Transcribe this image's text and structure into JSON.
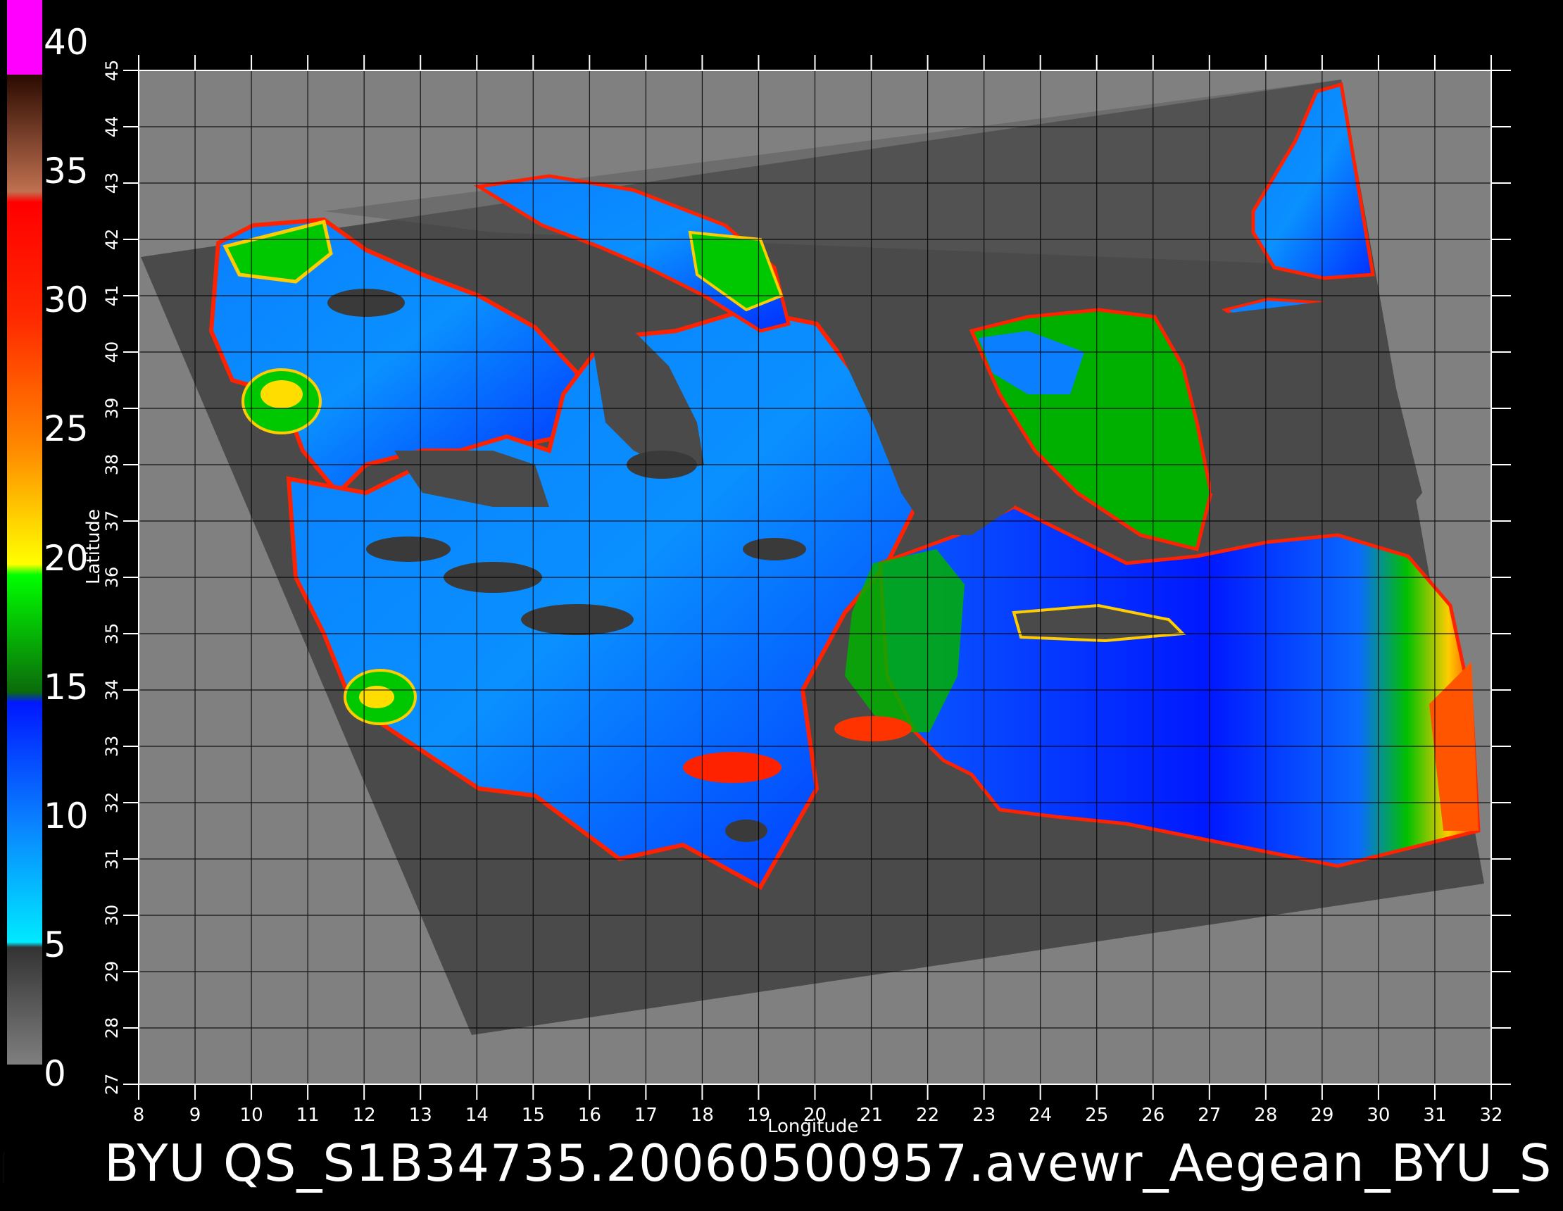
{
  "map": {
    "region": "Aegean",
    "x_axis_title": "Longitude",
    "y_axis_title": "Latitude",
    "x_ticks": [
      "8",
      "9",
      "10",
      "11",
      "12",
      "13",
      "14",
      "15",
      "16",
      "17",
      "18",
      "19",
      "20",
      "21",
      "22",
      "23",
      "24",
      "25",
      "26",
      "27",
      "28",
      "29",
      "30",
      "31",
      "32"
    ],
    "y_ticks": [
      "27",
      "28",
      "29",
      "30",
      "31",
      "32",
      "33",
      "34",
      "35",
      "36",
      "37",
      "38",
      "39",
      "40",
      "41",
      "42",
      "43",
      "44",
      "45"
    ],
    "lon_range": [
      8,
      32
    ],
    "lat_range": [
      27,
      45
    ],
    "background_color": "#808080",
    "swath_color": "#4a4a4a",
    "land_color": "#4a4a4a"
  },
  "colorbar": {
    "labels": [
      "40",
      "35",
      "30",
      "25",
      "20",
      "15",
      "10",
      "5",
      "0"
    ],
    "range": [
      0,
      40
    ],
    "stops": [
      {
        "value": 0,
        "color": "#7f7f7f"
      },
      {
        "value": 5,
        "color": "#333333"
      },
      {
        "value": 5,
        "color": "#00eaff"
      },
      {
        "value": 10,
        "color": "#0a7fff"
      },
      {
        "value": 15,
        "color": "#0018ff"
      },
      {
        "value": 15,
        "color": "#0b6b0b"
      },
      {
        "value": 20,
        "color": "#00ff00"
      },
      {
        "value": 20,
        "color": "#ffff00"
      },
      {
        "value": 25,
        "color": "#ff8800"
      },
      {
        "value": 30,
        "color": "#ff2a00"
      },
      {
        "value": 30,
        "color": "#ff0000"
      },
      {
        "value": 35,
        "color": "#ff1010"
      },
      {
        "value": 35,
        "color": "#c07050"
      },
      {
        "value": 40,
        "color": "#2a0a00"
      },
      {
        "value": 40,
        "color": "#ff00ff"
      }
    ]
  },
  "footer": {
    "title": "BYU  QS_S1B34735.20060500957.avewr_Aegean_BYU_S",
    "edge_glyph": "E"
  }
}
